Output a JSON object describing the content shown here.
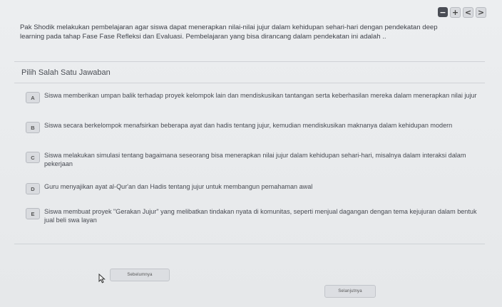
{
  "controls": {
    "minus": "−",
    "plus": "+",
    "prev": "<",
    "next": ">"
  },
  "question": "Pak Shodik melakukan pembelajaran agar siswa dapat menerapkan nilai-nilai jujur dalam kehidupan sehari-hari dengan pendekatan deep learning pada tahap Fase Fase Refleksi dan Evaluasi. Pembelajaran yang bisa dirancang dalam pendekatan ini adalah ..",
  "instruction": "Pilih Salah Satu Jawaban",
  "options": [
    {
      "letter": "A",
      "text": "Siswa memberikan umpan balik terhadap proyek kelompok lain dan mendiskusikan tantangan serta keberhasilan mereka dalam menerapkan nilai jujur"
    },
    {
      "letter": "B",
      "text": "Siswa secara berkelompok menafsirkan beberapa ayat dan hadis tentang jujur, kemudian mendiskusikan maknanya dalam kehidupan modern"
    },
    {
      "letter": "C",
      "text": "Siswa melakukan simulasi tentang bagaimana seseorang bisa menerapkan nilai jujur dalam kehidupan sehari-hari, misalnya dalam interaksi dalam pekerjaan"
    },
    {
      "letter": "D",
      "text": "Guru menyajikan ayat al-Qur'an dan Hadis tentang jujur untuk membangun pemahaman awal"
    },
    {
      "letter": "E",
      "text": "Siswa membuat proyek \"Gerakan Jujur\" yang melibatkan tindakan nyata di komunitas, seperti menjual dagangan dengan tema kejujuran dalam bentuk jual beli swa layan"
    }
  ],
  "buttons": {
    "prev": "Sebelumnya",
    "next": "Selanjutnya"
  }
}
